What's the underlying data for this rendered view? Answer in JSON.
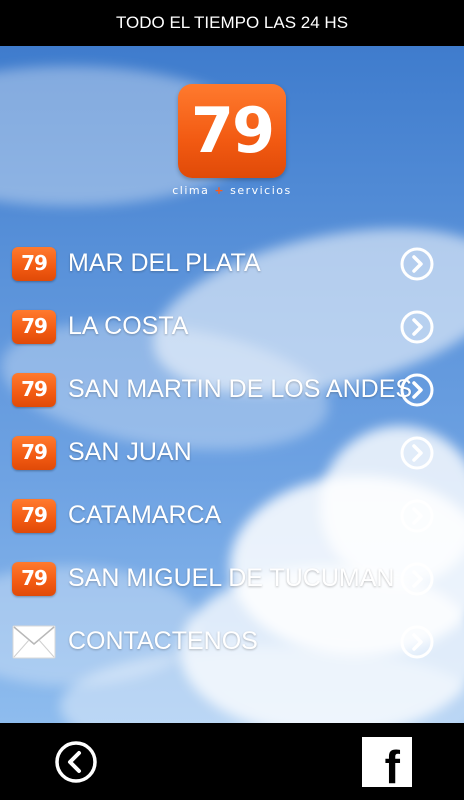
{
  "header": {
    "title": "TODO EL TIEMPO LAS 24 HS"
  },
  "logo": {
    "number": "79",
    "tagline_left": "clima",
    "tagline_plus": "+",
    "tagline_right": "servicios"
  },
  "menu": {
    "items": [
      {
        "badge": "79",
        "label": "MAR DEL PLATA",
        "icon": "chevron-right-circle-icon"
      },
      {
        "badge": "79",
        "label": "LA COSTA",
        "icon": "chevron-right-circle-icon"
      },
      {
        "badge": "79",
        "label": "SAN MARTIN DE LOS ANDES",
        "icon": "chevron-right-circle-icon"
      },
      {
        "badge": "79",
        "label": "SAN JUAN",
        "icon": "chevron-right-circle-icon"
      },
      {
        "badge": "79",
        "label": "CATAMARCA",
        "icon": "chevron-right-circle-icon"
      },
      {
        "badge": "79",
        "label": "SAN MIGUEL DE TUCUMAN",
        "icon": "chevron-right-circle-icon"
      },
      {
        "badge": "",
        "label": "CONTACTENOS",
        "icon": "chevron-right-circle-icon"
      }
    ]
  },
  "footer": {
    "back_icon": "chevron-left-circle-icon",
    "facebook_letter": "f"
  },
  "colors": {
    "brand_orange": "#f25a12",
    "sky_blue": "#5b93da",
    "bar_black": "#000000"
  }
}
